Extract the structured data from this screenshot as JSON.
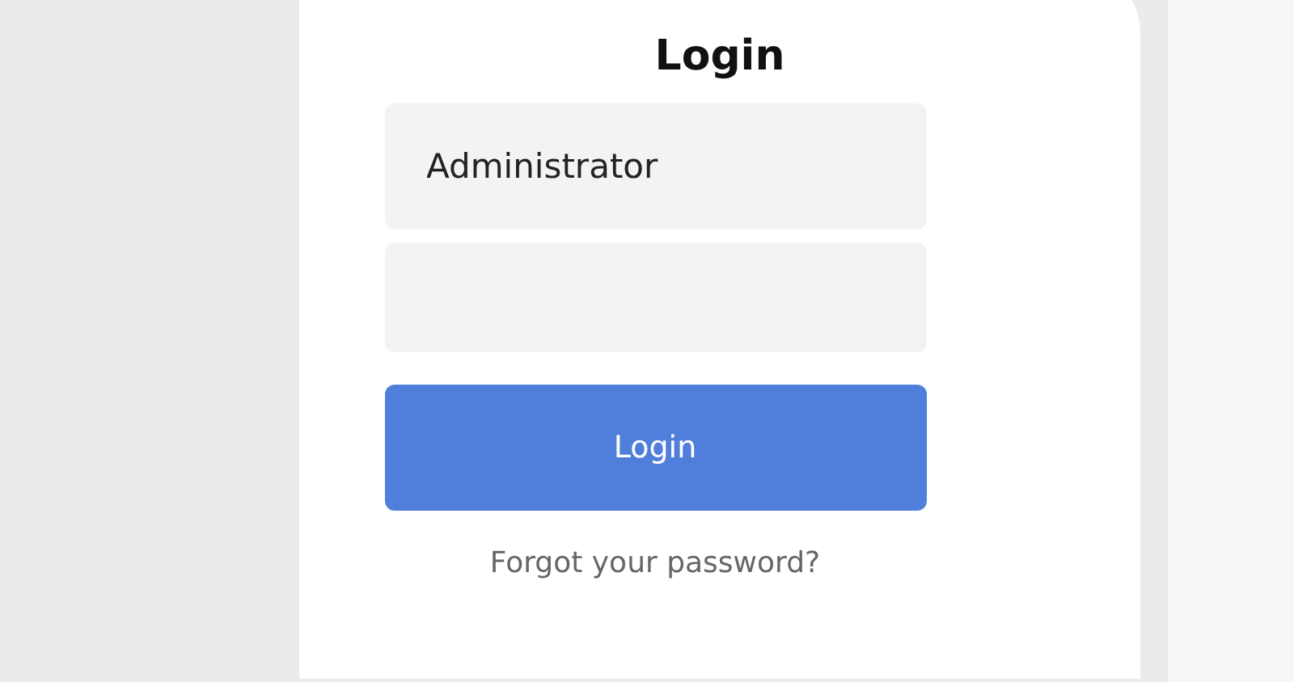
{
  "title": "Login",
  "username": {
    "value": "Administrator"
  },
  "button": "Login",
  "forgot_link": "Forgot your password?"
}
